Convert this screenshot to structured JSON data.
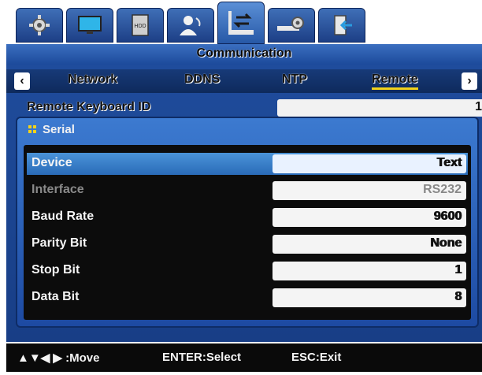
{
  "top_tabs": [
    {
      "icon": "gear-icon"
    },
    {
      "icon": "monitor-icon"
    },
    {
      "icon": "hdd-icon",
      "text": "HDD"
    },
    {
      "icon": "user-icon"
    },
    {
      "icon": "network-communication-icon",
      "active": true
    },
    {
      "icon": "device-settings-icon"
    },
    {
      "icon": "exit-icon"
    }
  ],
  "title": "Communication",
  "sub_tabs": {
    "items": [
      "Network",
      "DDNS",
      "NTP",
      "Remote"
    ],
    "active": "Remote",
    "prev_label": "‹",
    "next_label": "›"
  },
  "remote_keyboard": {
    "label": "Remote Keyboard ID",
    "value": "1"
  },
  "dialog": {
    "title": "Serial",
    "rows": [
      {
        "label": "Device",
        "value": "Text",
        "selected": true
      },
      {
        "label": "Interface",
        "value": "RS232",
        "disabled": true
      },
      {
        "label": "Baud Rate",
        "value": "9600"
      },
      {
        "label": "Parity Bit",
        "value": "None"
      },
      {
        "label": "Stop Bit",
        "value": "1"
      },
      {
        "label": "Data Bit",
        "value": "8"
      }
    ]
  },
  "status": {
    "move": "▲▼◀ ▶ :Move",
    "select": "ENTER:Select",
    "exit": "ESC:Exit"
  },
  "colors": {
    "accent": "#2758a6",
    "highlight": "#f3d21a",
    "selection": "#3a83cc"
  }
}
